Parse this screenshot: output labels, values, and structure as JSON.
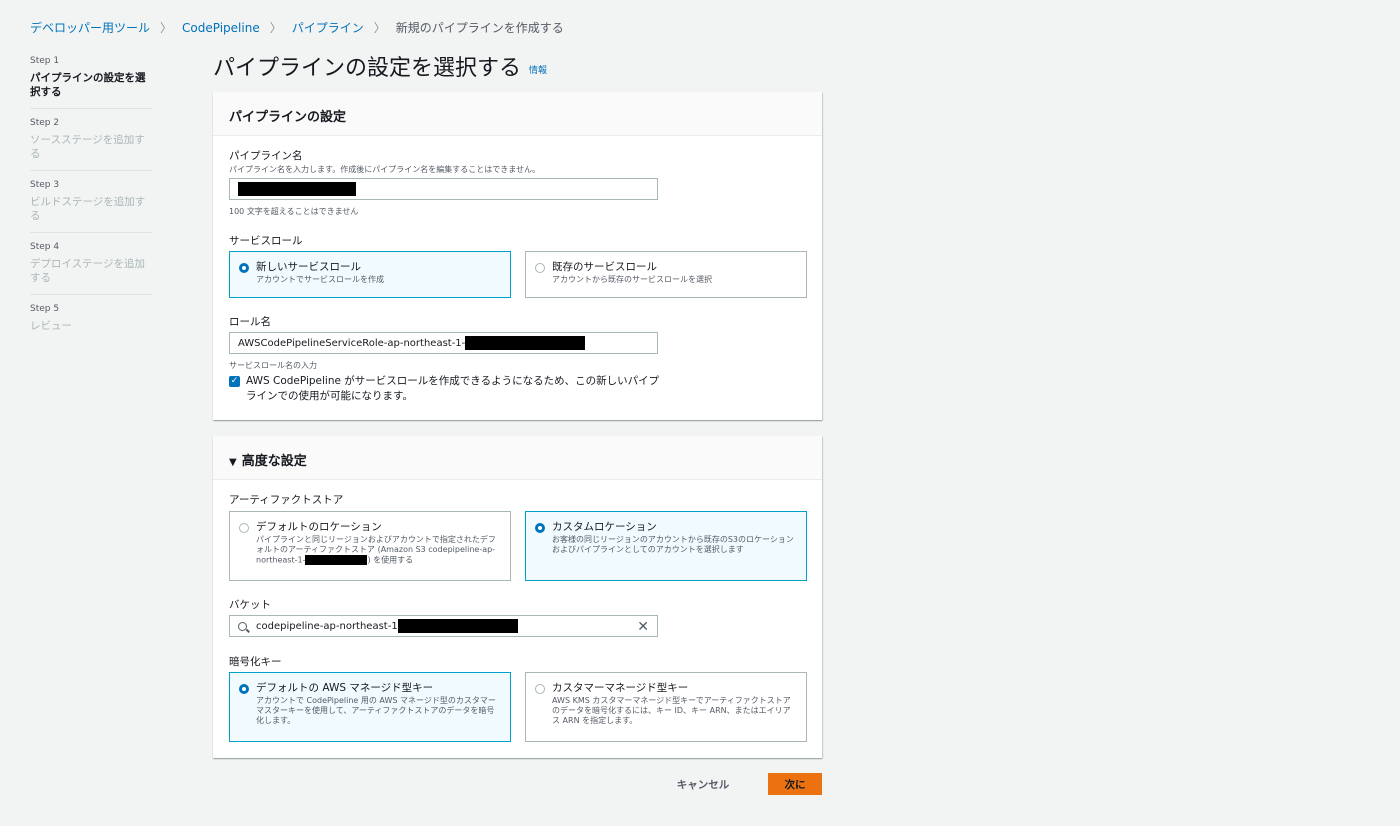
{
  "breadcrumb": {
    "items": [
      "デベロッパー用ツール",
      "CodePipeline",
      "パイプライン"
    ],
    "current": "新規のパイプラインを作成する"
  },
  "steps": [
    {
      "num": "Step 1",
      "name": "パイプラインの設定を選択する"
    },
    {
      "num": "Step 2",
      "name": "ソースステージを追加する"
    },
    {
      "num": "Step 3",
      "name": "ビルドステージを追加する"
    },
    {
      "num": "Step 4",
      "name": "デプロイステージを追加する"
    },
    {
      "num": "Step 5",
      "name": "レビュー"
    }
  ],
  "page": {
    "title": "パイプラインの設定を選択する",
    "info": "情報"
  },
  "settings": {
    "header": "パイプラインの設定",
    "pipeline_name_label": "パイプライン名",
    "pipeline_name_desc": "パイプライン名を入力します。作成後にパイプライン名を編集することはできません。",
    "pipeline_name_hint": "100 文字を超えることはできません",
    "service_role_label": "サービスロール",
    "new_role_title": "新しいサービスロール",
    "new_role_desc": "アカウントでサービスロールを作成",
    "existing_role_title": "既存のサービスロール",
    "existing_role_desc": "アカウントから既存のサービスロールを選択",
    "role_name_label": "ロール名",
    "role_name_value": "AWSCodePipelineServiceRole-ap-northeast-1-",
    "role_name_hint": "サービスロール名の入力",
    "checkbox_text": "AWS CodePipeline がサービスロールを作成できるようになるため、この新しいパイプラインでの使用が可能になります。"
  },
  "advanced": {
    "header": "高度な設定",
    "artifact_label": "アーティファクトストア",
    "default_loc_title": "デフォルトのロケーション",
    "default_loc_desc_pre": "パイプラインと同じリージョンおよびアカウントで指定されたデフォルトのアーティファクトストア (Amazon S3 codepipeline-ap-northeast-1-",
    "default_loc_desc_post": ") を使用する",
    "custom_loc_title": "カスタムロケーション",
    "custom_loc_desc": "お客様の同じリージョンのアカウントから既存のS3のロケーションおよびパイプラインとしてのアカウントを選択します",
    "bucket_label": "バケット",
    "bucket_value": "codepipeline-ap-northeast-1",
    "encryption_label": "暗号化キー",
    "default_key_title": "デフォルトの AWS マネージド型キー",
    "default_key_desc": "アカウントで CodePipeline 用の AWS マネージド型のカスタマーマスターキーを使用して、アーティファクトストアのデータを暗号化します。",
    "customer_key_title": "カスタマーマネージド型キー",
    "customer_key_desc": "AWS KMS カスタマーマネージド型キーでアーティファクトストアのデータを暗号化するには、キー ID、キー ARN、またはエイリアス ARN を指定します。"
  },
  "actions": {
    "cancel": "キャンセル",
    "next": "次に"
  },
  "colors": {
    "primary": "#ec7211",
    "link": "#0073bb",
    "selected_border": "#00a1c9"
  }
}
